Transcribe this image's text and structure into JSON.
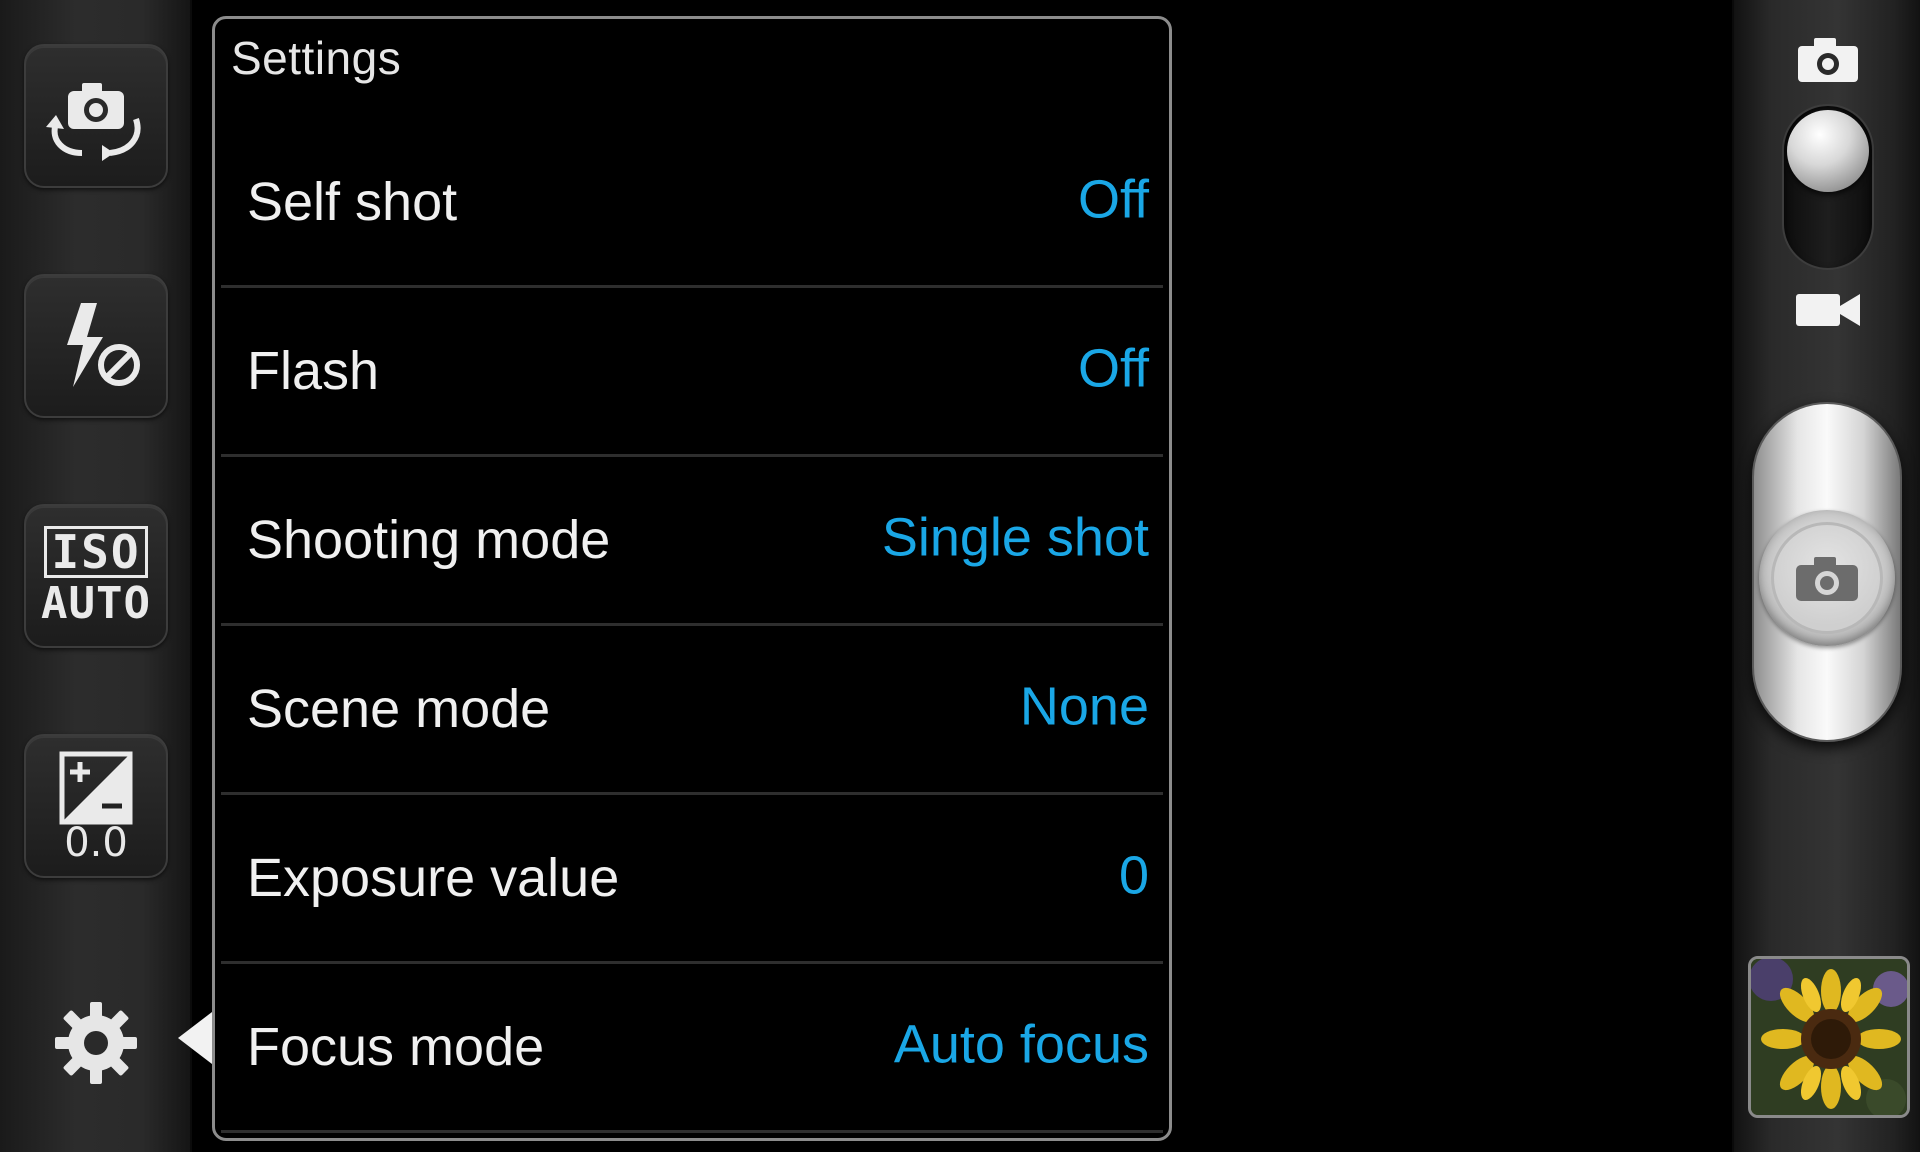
{
  "left_toolbar": {
    "buttons": [
      {
        "name": "self-shot-switch-button",
        "icon": "camera-switch-icon"
      },
      {
        "name": "flash-button",
        "icon": "flash-off-icon"
      },
      {
        "name": "iso-button",
        "icon": "iso-auto-icon",
        "text_line1": "ISO",
        "text_line2": "AUTO"
      },
      {
        "name": "exposure-button",
        "icon": "exposure-icon",
        "value": "0.0"
      }
    ],
    "settings_icon": "gear-icon"
  },
  "settings": {
    "title": "Settings",
    "rows": [
      {
        "label": "Self shot",
        "value": "Off"
      },
      {
        "label": "Flash",
        "value": "Off"
      },
      {
        "label": "Shooting mode",
        "value": "Single shot"
      },
      {
        "label": "Scene mode",
        "value": "None"
      },
      {
        "label": "Exposure value",
        "value": "0"
      },
      {
        "label": "Focus mode",
        "value": "Auto focus"
      }
    ]
  },
  "right_bar": {
    "mode_switch": {
      "selected": "camera",
      "options": [
        "camera",
        "video"
      ]
    },
    "shutter_icon": "camera-icon",
    "gallery_thumbnail": "sunflower-thumbnail"
  },
  "colors": {
    "accent": "#1aa7e6",
    "label": "#f0f0f0",
    "panel_border": "#8c8c8c"
  }
}
